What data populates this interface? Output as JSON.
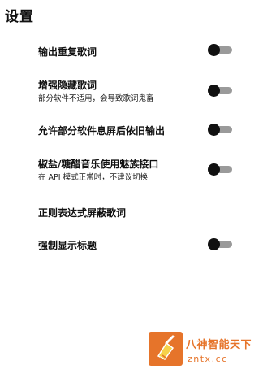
{
  "page": {
    "title": "设置"
  },
  "settings": [
    {
      "id": "output-duplicate",
      "title": "输出重复歌词",
      "subtitle": "",
      "has_toggle": true,
      "enabled": false
    },
    {
      "id": "enhance-hide",
      "title": "增强隐藏歌词",
      "subtitle": "部分软件不适用，会导致歌词鬼畜",
      "has_toggle": true,
      "enabled": false
    },
    {
      "id": "allow-screen-off",
      "title": "允许部分软件息屏后依旧输出",
      "subtitle": "",
      "has_toggle": true,
      "enabled": false
    },
    {
      "id": "meizu-api",
      "title": "椒盐/糖醋音乐使用魅族接口",
      "subtitle": "在 API 模式正常时，不建议切换",
      "has_toggle": true,
      "enabled": false
    },
    {
      "id": "regex-block",
      "title": "正则表达式屏蔽歌词",
      "subtitle": "",
      "has_toggle": false,
      "enabled": false
    },
    {
      "id": "force-title",
      "title": "强制显示标题",
      "subtitle": "",
      "has_toggle": true,
      "enabled": false
    }
  ],
  "watermark": {
    "text": "八神智能天下",
    "url": "zntx.cc"
  },
  "colors": {
    "background": "#ffffff",
    "text": "#111111",
    "toggle_thumb": "#111111",
    "toggle_track": "#9a9a9a",
    "watermark": "#e6742a"
  },
  "icons": {
    "watermark_logo": "broom-logo-icon"
  }
}
